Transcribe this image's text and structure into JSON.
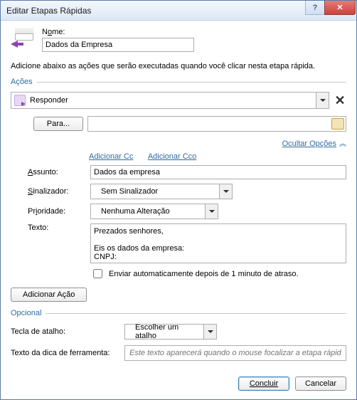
{
  "titlebar": {
    "title": "Editar Etapas Rápidas",
    "help_icon": "?",
    "close_icon": "✕"
  },
  "header": {
    "name_label_pre": "N",
    "name_label_u": "o",
    "name_label_post": "me:",
    "name_value": "Dados da Empresa"
  },
  "intro": "Adicione abaixo as ações que serão executadas quando você clicar nesta etapa rápida.",
  "sections": {
    "actions": "Ações",
    "optional": "Opcional"
  },
  "action": {
    "type": "Responder",
    "remove_title": "Remover ação",
    "para_label": "Para...",
    "hide_options": "Ocultar Opções",
    "add_cc": "Adicionar Cc",
    "add_cco": "Adicionar Cco",
    "subject_label_u": "A",
    "subject_label_post": "ssunto:",
    "subject_value": "Dados da empresa",
    "flag_label_u": "S",
    "flag_label_post": "inalizador:",
    "flag_value": "Sem Sinalizador",
    "priority_label_pre": "Pr",
    "priority_label_u": "i",
    "priority_label_post": "oridade:",
    "priority_value": "Nenhuma Alteração",
    "text_label": "Texto:",
    "text_value": "Prezados senhores,\n\nEis os dados da empresa:\nCNPJ: ",
    "auto_send": "Enviar automaticamente depois de 1 minuto de atraso."
  },
  "add_action": "Adicionar Ação",
  "optional": {
    "shortcut_label_pre": "T",
    "shortcut_label_u": "e",
    "shortcut_label_post": "cla de atalho:",
    "shortcut_value": "Escolher um atalho",
    "tooltip_label_pre": "Te",
    "tooltip_label_u": "x",
    "tooltip_label_post": "to da dica de ferramenta:",
    "tooltip_placeholder": "Este texto aparecerá quando o mouse focalizar a etapa rápida."
  },
  "footer": {
    "ok": "Concluir",
    "cancel": "Cancelar"
  }
}
